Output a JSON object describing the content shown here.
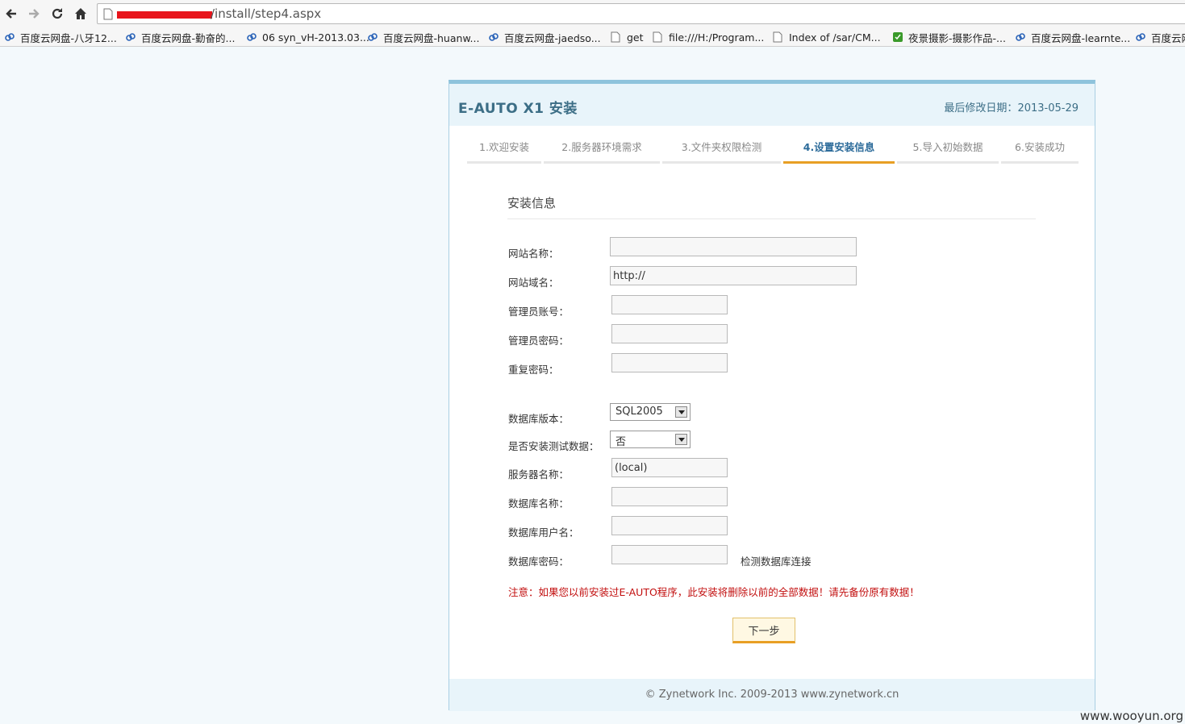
{
  "browser": {
    "url_suffix": "/install/step4.aspx",
    "bookmarks": [
      {
        "label": "百度云网盘-八牙12...",
        "icon": "cloud-icon"
      },
      {
        "label": "百度云网盘-勤奋的...",
        "icon": "cloud-icon"
      },
      {
        "label": "06 syn_vH-2013.03...",
        "icon": "cloud-icon"
      },
      {
        "label": "百度云网盘-huanw...",
        "icon": "cloud-icon"
      },
      {
        "label": "百度云网盘-jaedso...",
        "icon": "cloud-icon"
      },
      {
        "label": "get",
        "icon": "page-icon"
      },
      {
        "label": "file:///H:/Program...",
        "icon": "page-icon"
      },
      {
        "label": "Index of /sar/CM...",
        "icon": "page-icon"
      },
      {
        "label": "夜景摄影-摄影作品-...",
        "icon": "photo-icon"
      },
      {
        "label": "百度云网盘-learnte...",
        "icon": "cloud-icon"
      },
      {
        "label": "百度云网",
        "icon": "cloud-icon"
      }
    ]
  },
  "header": {
    "title": "E-AUTO X1 安装",
    "date_label": "最后修改日期：",
    "date_value": "2013-05-29"
  },
  "steps": [
    {
      "label": "1.欢迎安装",
      "active": false
    },
    {
      "label": "2.服务器环境需求",
      "active": false
    },
    {
      "label": "3.文件夹权限检测",
      "active": false
    },
    {
      "label": "4.设置安装信息",
      "active": true
    },
    {
      "label": "5.导入初始数据",
      "active": false
    },
    {
      "label": "6.安装成功",
      "active": false
    }
  ],
  "form": {
    "section_title": "安装信息",
    "site_name_label": "网站名称：",
    "site_name_value": "",
    "site_domain_label": "网站域名：",
    "site_domain_value": "http://",
    "admin_account_label": "管理员账号：",
    "admin_account_value": "",
    "admin_password_label": "管理员密码：",
    "admin_password_value": "",
    "repeat_password_label": "重复密码：",
    "repeat_password_value": "",
    "db_version_label": "数据库版本：",
    "db_version_value": "SQL2005",
    "test_data_label": "是否安装测试数据：",
    "test_data_value": "否",
    "server_name_label": "服务器名称：",
    "server_name_value": "(local)",
    "db_name_label": "数据库名称：",
    "db_name_value": "",
    "db_user_label": "数据库用户名：",
    "db_user_value": "",
    "db_password_label": "数据库密码：",
    "db_password_value": "",
    "check_connection": "检测数据库连接",
    "notice": "注意：如果您以前安装过E-AUTO程序，此安装将删除以前的全部数据！请先备份原有数据！",
    "next_button": "下一步"
  },
  "footer": {
    "copyright": "© Zynetwork Inc. 2009-2013 www.zynetwork.cn"
  },
  "watermark": "www.wooyun.org",
  "colors": {
    "accent": "#e89f24",
    "title": "#3c6e86",
    "notice": "#c20f0f",
    "active_step": "#2c6b9a"
  }
}
